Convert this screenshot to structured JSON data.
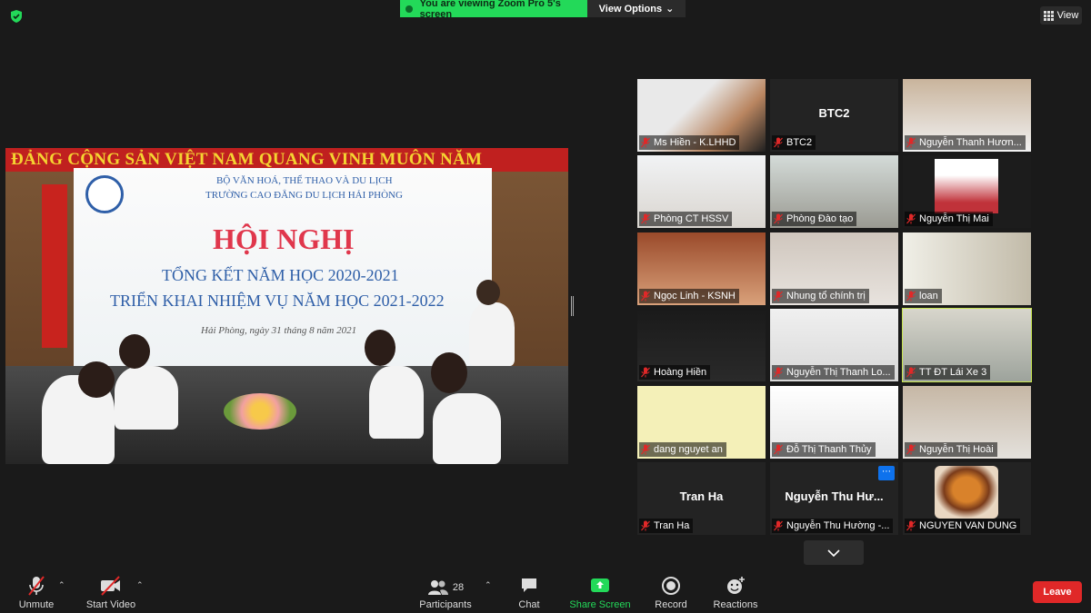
{
  "banner": {
    "text": "You are viewing Zoom Pro 5's screen"
  },
  "view_options": {
    "label": "View Options"
  },
  "view_button": {
    "label": "View"
  },
  "shared_screen": {
    "slogan": "ĐẢNG CỘNG SẢN VIỆT NAM QUANG VINH MUÔN NĂM",
    "ministry": "BỘ VĂN HOÁ, THỂ THAO VÀ DU LỊCH",
    "school": "TRƯỜNG CAO ĐẲNG DU LỊCH HẢI PHÒNG",
    "headline": "HỘI NGHỊ",
    "line1": "TỔNG KẾT NĂM HỌC 2020-2021",
    "line2": "TRIỂN KHAI NHIỆM VỤ NĂM HỌC 2021-2022",
    "date": "Hải Phòng, ngày 31 tháng 8 năm 2021"
  },
  "participants": [
    {
      "name": "Ms Hiền - K.LHHD",
      "muted": true
    },
    {
      "name": "BTC2",
      "center": "BTC2",
      "muted": true
    },
    {
      "name": "Nguyễn Thanh Hươn...",
      "muted": true
    },
    {
      "name": "Phòng CT HSSV",
      "muted": true
    },
    {
      "name": "Phòng Đào tạo",
      "muted": true
    },
    {
      "name": "Nguyễn Thị Mai",
      "muted": true
    },
    {
      "name": "Ngọc Linh - KSNH",
      "muted": true
    },
    {
      "name": "Nhung tổ chính trị",
      "muted": true
    },
    {
      "name": "loan",
      "muted": true
    },
    {
      "name": "Hoàng Hiền",
      "muted": true
    },
    {
      "name": "Nguyễn Thị Thanh Lo...",
      "muted": true
    },
    {
      "name": "TT ĐT Lái Xe 3",
      "muted": true,
      "active": true
    },
    {
      "name": "dang nguyet an",
      "muted": true
    },
    {
      "name": "Đỗ Thị Thanh Thủy",
      "muted": true
    },
    {
      "name": "Nguyễn Thị Hoài",
      "muted": true
    },
    {
      "name": "Tran Ha",
      "center": "Tran Ha",
      "muted": true
    },
    {
      "name": "Nguyễn Thu Hường -...",
      "center": "Nguyễn Thu Hư...",
      "muted": true
    },
    {
      "name": "NGUYEN VAN DUNG",
      "muted": true
    }
  ],
  "toolbar": {
    "unmute": "Unmute",
    "start_video": "Start Video",
    "participants": "Participants",
    "participants_count": "28",
    "chat": "Chat",
    "share_screen": "Share Screen",
    "record": "Record",
    "reactions": "Reactions",
    "leave": "Leave"
  },
  "colors": {
    "accent_green": "#23d959",
    "leave_red": "#e02828",
    "active_speaker": "#c8e650",
    "mute_red": "#e02828"
  }
}
